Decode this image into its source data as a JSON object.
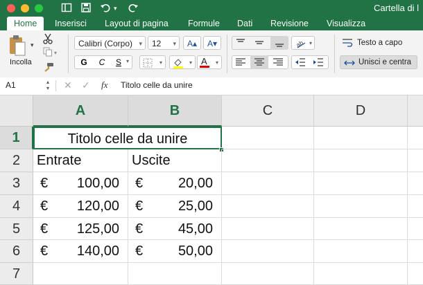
{
  "window": {
    "title": "Cartella di l"
  },
  "ribbon_tabs": [
    "Home",
    "Inserisci",
    "Layout di pagina",
    "Formule",
    "Dati",
    "Revisione",
    "Visualizza"
  ],
  "ribbon": {
    "paste_label": "Incolla",
    "font_name": "Calibri (Corpo)",
    "font_size": "12",
    "increase_font": "A▴",
    "decrease_font": "A▾",
    "bold": "G",
    "italic": "C",
    "underline": "S",
    "font_color_letter": "A",
    "wrap_text": "Testo a capo",
    "merge_center": "Unisci e centra",
    "highlight_color": "#ffff00",
    "font_color": "#e00000"
  },
  "formula_bar": {
    "name_box": "A1",
    "fx": "fx",
    "content": "Titolo celle da unire"
  },
  "sheet": {
    "columns": [
      "A",
      "B",
      "C",
      "D"
    ],
    "rows": [
      "1",
      "2",
      "3",
      "4",
      "5",
      "6",
      "7"
    ],
    "merged_title": "Titolo celle da unire",
    "headers": [
      "Entrate",
      "Uscite"
    ],
    "currency": "€",
    "entrate": [
      "100,00",
      "120,00",
      "125,00",
      "140,00"
    ],
    "uscite": [
      "20,00",
      "25,00",
      "45,00",
      "50,00"
    ]
  },
  "colors": {
    "accent": "#217346"
  }
}
